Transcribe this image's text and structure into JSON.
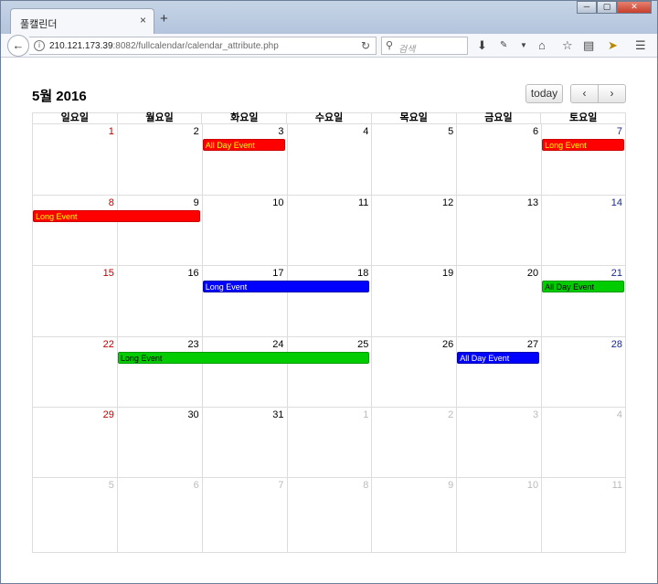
{
  "browser": {
    "tab_title": "풀캘린더",
    "tab_close": "×",
    "new_tab": "+",
    "url_host": "210.121.173.39",
    "url_rest": ":8082/fullcalendar/calendar_attribute.php",
    "search_placeholder": "검색",
    "win_min": "─",
    "win_max": "▢",
    "win_close": "✕"
  },
  "calendar": {
    "title": "5월 2016",
    "today_label": "today",
    "prev_label": "‹",
    "next_label": "›",
    "weekdays": [
      "일요일",
      "월요일",
      "화요일",
      "수요일",
      "목요일",
      "금요일",
      "토요일"
    ],
    "weeks": [
      [
        "1",
        "2",
        "3",
        "4",
        "5",
        "6",
        "7"
      ],
      [
        "8",
        "9",
        "10",
        "11",
        "12",
        "13",
        "14"
      ],
      [
        "15",
        "16",
        "17",
        "18",
        "19",
        "20",
        "21"
      ],
      [
        "22",
        "23",
        "24",
        "25",
        "26",
        "27",
        "28"
      ],
      [
        "29",
        "30",
        "31",
        "1",
        "2",
        "3",
        "4"
      ],
      [
        "5",
        "6",
        "7",
        "8",
        "9",
        "10",
        "11"
      ]
    ],
    "events": [
      {
        "title": "All Day Event",
        "color": "#ff0000"
      },
      {
        "title": "Long Event",
        "color": "#ff0000"
      },
      {
        "title": "Long Event",
        "color": "#ff0000"
      },
      {
        "title": "Long Event",
        "color": "#0000ff"
      },
      {
        "title": "All Day Event",
        "color": "#00cc00"
      },
      {
        "title": "Long Event",
        "color": "#00cc00"
      },
      {
        "title": "All Day Event",
        "color": "#0000ff"
      }
    ]
  }
}
